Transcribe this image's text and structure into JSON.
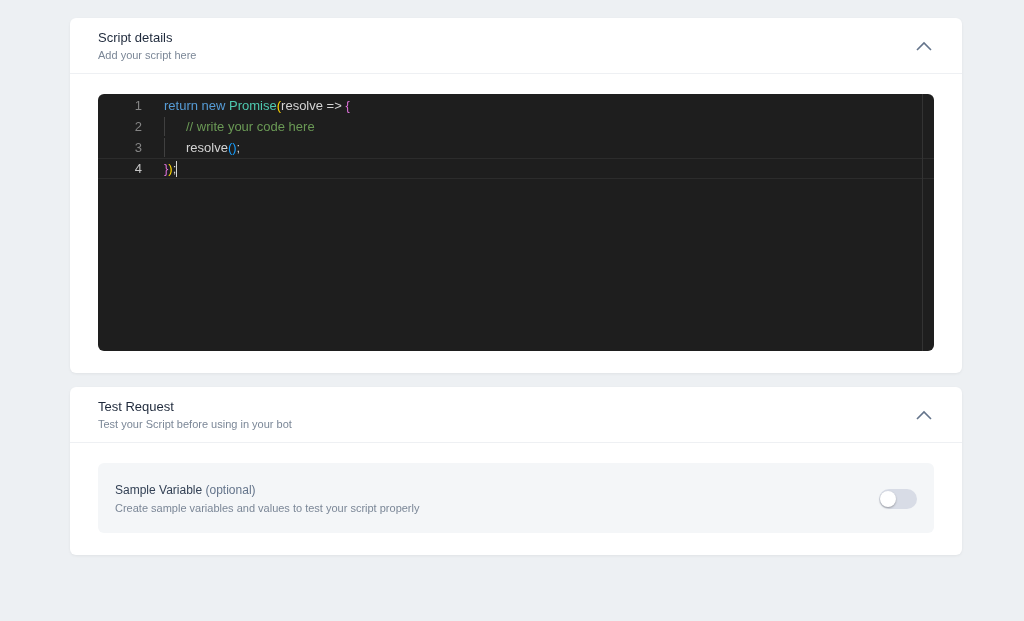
{
  "sections": [
    {
      "kind": "editor",
      "title": "Script details",
      "subtitle": "Add your script here",
      "expanded": true,
      "code_lines": [
        {
          "number": "1",
          "active": false,
          "indented": false,
          "tokens": [
            {
              "kind": "keyword",
              "text": "return new "
            },
            {
              "kind": "class",
              "text": "Promise"
            },
            {
              "kind": "bracket1",
              "text": "("
            },
            {
              "kind": "plain",
              "text": "resolve => "
            },
            {
              "kind": "bracket2",
              "text": "{"
            }
          ]
        },
        {
          "number": "2",
          "active": false,
          "indented": true,
          "tokens": [
            {
              "kind": "comment",
              "text": "// write your code here"
            }
          ]
        },
        {
          "number": "3",
          "active": false,
          "indented": true,
          "tokens": [
            {
              "kind": "plain",
              "text": "resolve"
            },
            {
              "kind": "bracket3",
              "text": "()"
            },
            {
              "kind": "plain",
              "text": ";"
            }
          ]
        },
        {
          "number": "4",
          "active": true,
          "indented": false,
          "tokens": [
            {
              "kind": "bracket2",
              "text": "}"
            },
            {
              "kind": "bracket1",
              "text": ")"
            },
            {
              "kind": "plain",
              "text": ";"
            }
          ]
        }
      ]
    },
    {
      "kind": "settings",
      "title": "Test Request",
      "subtitle": "Test your Script before using in your bot",
      "expanded": true,
      "setting": {
        "label": "Sample Variable",
        "label_note": "(optional)",
        "description": "Create sample variables and values to test your script properly",
        "on": false
      }
    }
  ]
}
